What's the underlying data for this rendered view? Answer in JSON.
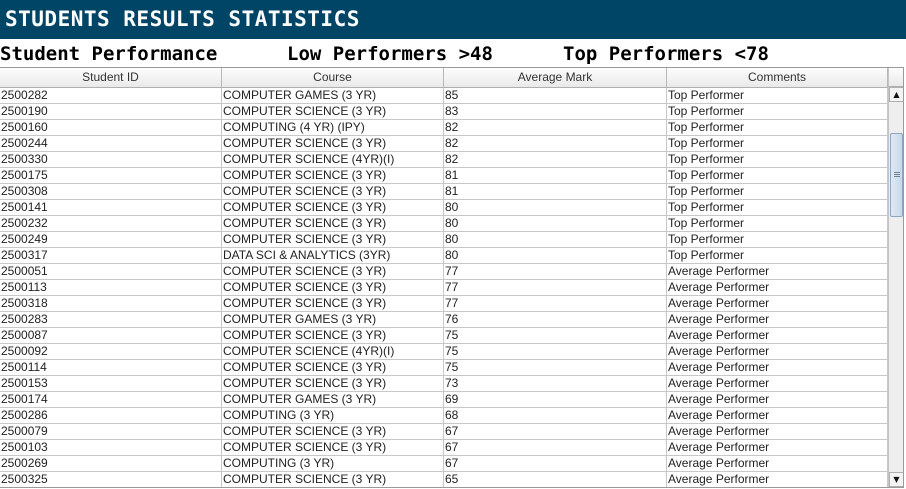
{
  "title": "STUDENTS RESULTS STATISTICS",
  "summary": {
    "performance_label": "Student Performance",
    "low_label": "Low Performers >48",
    "top_label": "Top Performers <78"
  },
  "table": {
    "headers": [
      "Student ID",
      "Course",
      "Average Mark",
      "Comments"
    ],
    "rows": [
      [
        "2500282",
        "COMPUTER GAMES (3 YR)",
        "85",
        "Top Performer"
      ],
      [
        "2500190",
        "COMPUTER SCIENCE (3 YR)",
        "83",
        "Top Performer"
      ],
      [
        "2500160",
        "COMPUTING (4 YR) (IPY)",
        "82",
        "Top Performer"
      ],
      [
        "2500244",
        "COMPUTER SCIENCE (3 YR)",
        "82",
        "Top Performer"
      ],
      [
        "2500330",
        "COMPUTER SCIENCE (4YR)(I)",
        "82",
        "Top Performer"
      ],
      [
        "2500175",
        "COMPUTER SCIENCE (3 YR)",
        "81",
        "Top Performer"
      ],
      [
        "2500308",
        "COMPUTER SCIENCE (3 YR)",
        "81",
        "Top Performer"
      ],
      [
        "2500141",
        "COMPUTER SCIENCE (3 YR)",
        "80",
        "Top Performer"
      ],
      [
        "2500232",
        "COMPUTER SCIENCE (3 YR)",
        "80",
        "Top Performer"
      ],
      [
        "2500249",
        "COMPUTER SCIENCE (3 YR)",
        "80",
        "Top Performer"
      ],
      [
        "2500317",
        "DATA SCI & ANALYTICS (3YR)",
        "80",
        "Top Performer"
      ],
      [
        "2500051",
        "COMPUTER SCIENCE (3 YR)",
        "77",
        "Average Performer"
      ],
      [
        "2500113",
        "COMPUTER SCIENCE (3 YR)",
        "77",
        "Average Performer"
      ],
      [
        "2500318",
        "COMPUTER SCIENCE (3 YR)",
        "77",
        "Average Performer"
      ],
      [
        "2500283",
        "COMPUTER GAMES (3 YR)",
        "76",
        "Average Performer"
      ],
      [
        "2500087",
        "COMPUTER SCIENCE (3 YR)",
        "75",
        "Average Performer"
      ],
      [
        "2500092",
        "COMPUTER SCIENCE (4YR)(I)",
        "75",
        "Average Performer"
      ],
      [
        "2500114",
        "COMPUTER SCIENCE (3 YR)",
        "75",
        "Average Performer"
      ],
      [
        "2500153",
        "COMPUTER SCIENCE (3 YR)",
        "73",
        "Average Performer"
      ],
      [
        "2500174",
        "COMPUTER GAMES (3 YR)",
        "69",
        "Average Performer"
      ],
      [
        "2500286",
        "COMPUTING (3 YR)",
        "68",
        "Average Performer"
      ],
      [
        "2500079",
        "COMPUTER SCIENCE (3 YR)",
        "67",
        "Average Performer"
      ],
      [
        "2500103",
        "COMPUTER SCIENCE (3 YR)",
        "67",
        "Average Performer"
      ],
      [
        "2500269",
        "COMPUTING (3 YR)",
        "67",
        "Average Performer"
      ],
      [
        "2500325",
        "COMPUTER SCIENCE (3 YR)",
        "65",
        "Average Performer"
      ]
    ]
  },
  "scrollbar": {
    "up_icon": "arrow-up-icon",
    "down_icon": "arrow-down-icon",
    "grip_icon": "grip-icon"
  },
  "colors": {
    "title_bar": "#004466",
    "title_text": "#ffffff"
  }
}
